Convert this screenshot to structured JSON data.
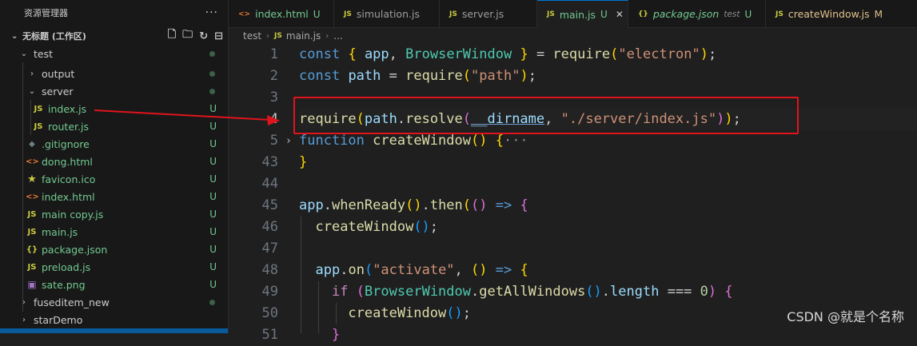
{
  "sidebar": {
    "title": "资源管理器",
    "more": "···",
    "workspace": "无标题 (工作区)",
    "root": "test",
    "items": [
      {
        "label": "output",
        "kind": "folder",
        "status": "",
        "dot": true
      },
      {
        "label": "server",
        "kind": "folder-open",
        "status": "",
        "dot": true
      },
      {
        "label": "index.js",
        "kind": "js",
        "status": "U"
      },
      {
        "label": "router.js",
        "kind": "js",
        "status": "U"
      },
      {
        "label": ".gitignore",
        "kind": "git",
        "status": "U"
      },
      {
        "label": "dong.html",
        "kind": "html",
        "status": "U"
      },
      {
        "label": "favicon.ico",
        "kind": "star",
        "status": "U"
      },
      {
        "label": "index.html",
        "kind": "html",
        "status": "U"
      },
      {
        "label": "main copy.js",
        "kind": "js",
        "status": "U"
      },
      {
        "label": "main.js",
        "kind": "js",
        "status": "U"
      },
      {
        "label": "package.json",
        "kind": "json",
        "status": "U"
      },
      {
        "label": "preload.js",
        "kind": "js",
        "status": "U"
      },
      {
        "label": "sate.png",
        "kind": "img",
        "status": "U"
      },
      {
        "label": "fuseditem_new",
        "kind": "folder",
        "status": "",
        "dot": true
      },
      {
        "label": "starDemo",
        "kind": "folder",
        "status": ""
      }
    ]
  },
  "tabs": [
    {
      "label": "index.html",
      "status": "U",
      "icon": "<>"
    },
    {
      "label": "simulation.js",
      "status": "",
      "icon": "JS"
    },
    {
      "label": "server.js",
      "status": "",
      "icon": "JS"
    },
    {
      "label": "main.js",
      "status": "U",
      "icon": "JS",
      "active": true
    },
    {
      "label": "package.json",
      "desc": "test",
      "status": "U",
      "icon": "{}"
    },
    {
      "label": "createWindow.js",
      "status": "M",
      "icon": "JS"
    }
  ],
  "breadcrumb": {
    "folder": "test",
    "file": "main.js",
    "more": "..."
  },
  "editor": {
    "line_numbers": [
      "1",
      "2",
      "3",
      "4",
      "5",
      "43",
      "44",
      "45",
      "46",
      "47",
      "48",
      "49",
      "50",
      "51"
    ],
    "current_line": "4"
  },
  "watermark": "CSDN @就是个名称",
  "colors": {
    "highlight": "#e0141d",
    "untracked": "#73c991",
    "modified": "#e2c08d",
    "accent": "#0078d4"
  }
}
